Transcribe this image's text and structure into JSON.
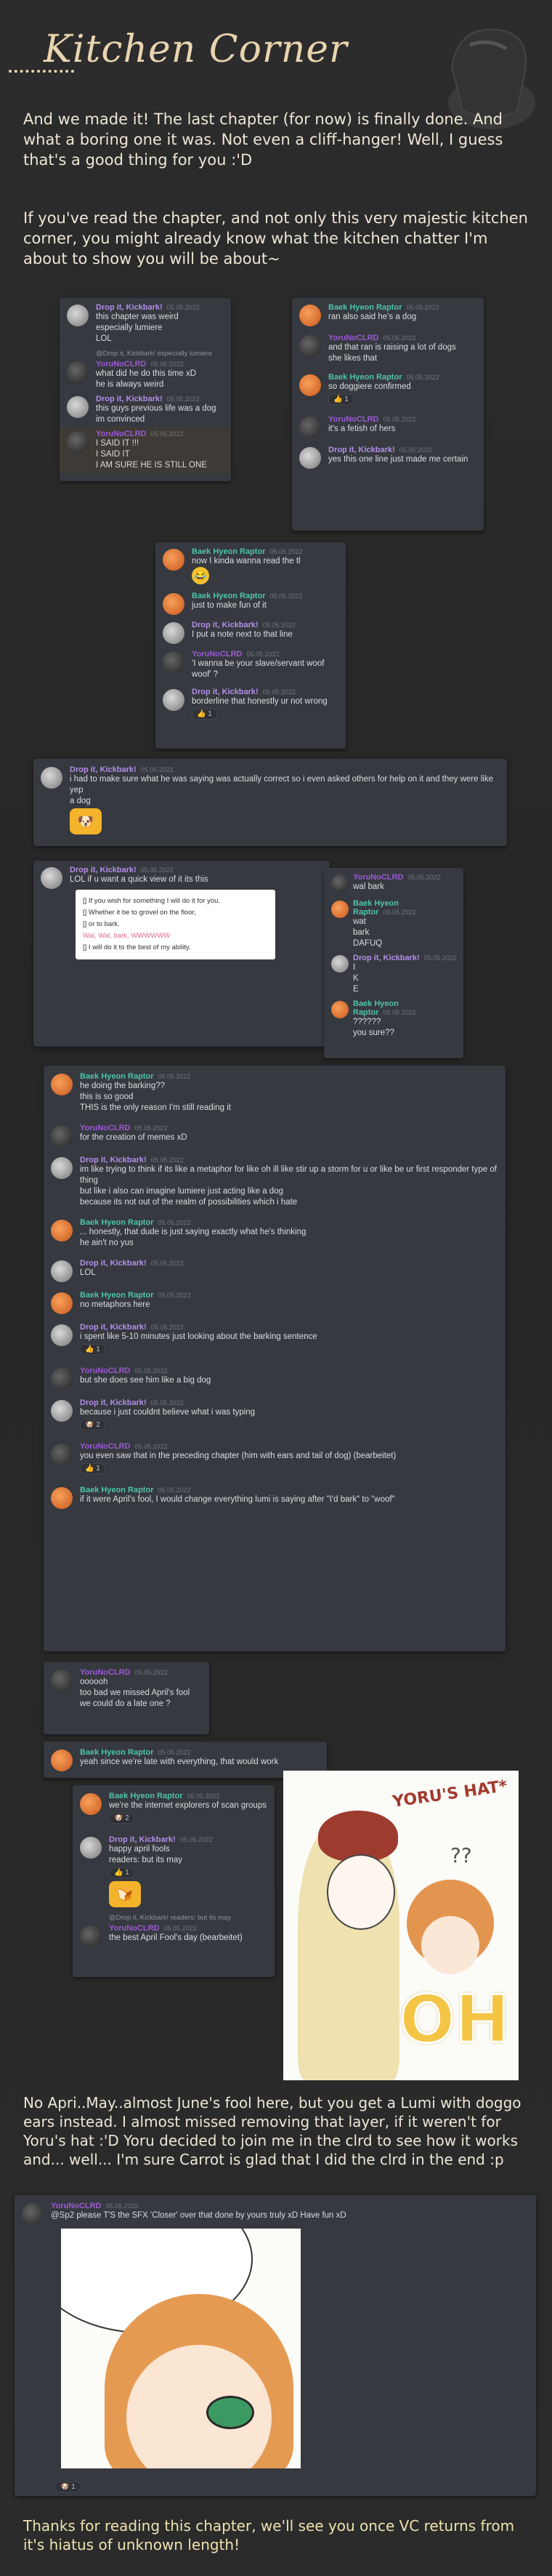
{
  "header": {
    "title": "Kitchen Corner",
    "decor_icon": "cooking-pot-icon"
  },
  "intro": {
    "p1": "And we made it! The last chapter (for now) is finally done. And what a boring one it was. Not even a cliff-hanger! Well, I guess that's a good thing for you :'D",
    "p2": "If you've read the chapter, and not only this very majestic kitchen corner, you might already know what the kitchen chatter I'm about to show you will be about~"
  },
  "mid_text": "No Apri..May..almost June's fool here, but you get a Lumi with doggo ears instead. I almost missed removing that layer, if it weren't for Yoru's hat :'D Yoru decided to join me in the clrd to see how it works and... well... I'm sure Carrot is glad that I did the clrd in the end :p",
  "outro": "Thanks for reading this chapter, we'll see you once VC returns from it's hiatus of unknown length!",
  "chat1": {
    "msgs": [
      {
        "user": "Drop it, Kickbark!",
        "time": "05.05.2022",
        "lines": [
          "this chapter was weird",
          "especially lumiere",
          "LOL"
        ]
      },
      {
        "reply": "@Drop it, Kickbark! especially lumiere",
        "user": "YoruNoCLRD",
        "time": "05.05.2022",
        "lines": [
          "what did he do this time xD",
          "he is always weird"
        ]
      },
      {
        "user": "Drop it, Kickbark!",
        "time": "05.05.2022",
        "lines": [
          "this guys previous life was a dog",
          "im convinced"
        ]
      },
      {
        "user": "YoruNoCLRD",
        "time": "05.05.2022",
        "lines": [
          "I SAID IT !!!",
          "I SAID IT",
          "I AM SURE HE IS STILL ONE"
        ]
      }
    ]
  },
  "chat2": {
    "msgs": [
      {
        "user": "Baek Hyeon Raptor",
        "time": "05.05.2022",
        "lines": [
          "ran also said he's a dog"
        ]
      },
      {
        "user": "YoruNoCLRD",
        "time": "05.05.2022",
        "lines": [
          "and that ran is raising a lot of dogs",
          "she likes that"
        ]
      },
      {
        "user": "Baek Hyeon Raptor",
        "time": "05.05.2022",
        "lines": [
          "so doggiere confirmed"
        ],
        "reaction": "1"
      },
      {
        "user": "YoruNoCLRD",
        "time": "05.05.2022",
        "lines": [
          "it's a fetish of hers"
        ]
      },
      {
        "user": "Drop it, Kickbark!",
        "time": "05.05.2022",
        "lines": [
          "yes this one line just made me certain"
        ]
      }
    ]
  },
  "chat3": {
    "msgs": [
      {
        "user": "Baek Hyeon Raptor",
        "time": "05.05.2022",
        "lines": [
          "now I kinda wanna read the tl"
        ]
      },
      {
        "user": "Baek Hyeon Raptor",
        "time": "05.05.2022",
        "lines": [
          "just to make fun of it"
        ]
      },
      {
        "user": "Drop it, Kickbark!",
        "time": "05.05.2022",
        "lines": [
          "I put a note next to that line"
        ]
      },
      {
        "user": "YoruNoCLRD",
        "time": "05.05.2022",
        "lines": [
          "'I wanna be your slave/servant woof woof' ?"
        ]
      },
      {
        "user": "Drop it, Kickbark!",
        "time": "05.05.2022",
        "lines": [
          "borderline that honestly ur not wrong"
        ],
        "reaction": "1"
      }
    ]
  },
  "chat4": {
    "msgs": [
      {
        "user": "Drop it, Kickbark!",
        "time": "05.05.2022",
        "lines": [
          "i had to make sure what he was saying was actually correct so i even asked others for help on it and they were like yep",
          "a dog"
        ]
      }
    ]
  },
  "chat5": {
    "msgs": [
      {
        "user": "Drop it, Kickbark!",
        "time": "05.05.2022",
        "lines": [
          "LOL if u want a quick view of it its this"
        ]
      }
    ],
    "popup": [
      "[] If you wish for something I will do it for you.",
      "[] Whether it be to grovel on the floor,",
      "[] or to bark.",
      "Wal, Wal, bark, WWWWWW",
      "[] I will do it to the best of my ability."
    ]
  },
  "chat6": {
    "msgs": [
      {
        "user": "YoruNoCLRD",
        "time": "05.05.2022",
        "lines": [
          "wal bark"
        ]
      },
      {
        "user": "Baek Hyeon Raptor",
        "time": "05.05.2022",
        "lines": [
          "wat",
          "bark",
          "DAFUQ"
        ]
      },
      {
        "user": "Drop it, Kickbark!",
        "time": "05.05.2022",
        "lines": [
          "I",
          "K",
          "E"
        ]
      },
      {
        "user": "Baek Hyeon Raptor",
        "time": "05.05.2022",
        "lines": [
          "??????",
          "you sure??"
        ]
      }
    ]
  },
  "chat7": {
    "msgs": [
      {
        "user": "Baek Hyeon Raptor",
        "time": "05.05.2022",
        "lines": [
          "he doing the barking??",
          "this is so good",
          "THIS is the only reason I'm still reading it"
        ]
      },
      {
        "user": "YoruNoCLRD",
        "time": "05.05.2022",
        "lines": [
          "for the creation of memes xD"
        ]
      },
      {
        "user": "Drop it, Kickbark!",
        "time": "05.05.2022",
        "lines": [
          "im like trying to think if its like a metaphor for like oh ill like stir up a storm for u or like be ur first responder type of thing",
          "but like i also can imagine lumiere just acting like a dog",
          "because its not out of the realm of possibilities which i hate"
        ]
      },
      {
        "user": "Baek Hyeon Raptor",
        "time": "05.05.2022",
        "lines": [
          "... honestly, that dude is just saying exactly what he's thinking",
          "he ain't no yus"
        ]
      },
      {
        "user": "Drop it, Kickbark!",
        "time": "05.05.2022",
        "lines": [
          "LOL"
        ]
      },
      {
        "user": "Baek Hyeon Raptor",
        "time": "05.05.2022",
        "lines": [
          "no metaphors here"
        ]
      },
      {
        "user": "Drop it, Kickbark!",
        "time": "05.05.2022",
        "lines": [
          "i spent like 5-10 minutes just looking about the barking sentence"
        ],
        "reaction": "1"
      },
      {
        "user": "YoruNoCLRD",
        "time": "05.05.2022",
        "lines": [
          "but she does see him like a big dog"
        ]
      },
      {
        "user": "Drop it, Kickbark!",
        "time": "05.05.2022",
        "lines": [
          "because i just couldnt believe what i was typing"
        ],
        "reaction": "2"
      },
      {
        "user": "YoruNoCLRD",
        "time": "05.05.2022",
        "lines": [
          "you even saw that in the preceding chapter (him with ears and tail of dog) (bearbeitet)"
        ],
        "reaction": "1"
      },
      {
        "user": "Baek Hyeon Raptor",
        "time": "05.05.2022",
        "lines": [
          "if it were April's fool, I would change everything lumi is saying after \"I'd bark\" to \"woof\""
        ]
      }
    ]
  },
  "chat8": {
    "msgs": [
      {
        "user": "YoruNoCLRD",
        "time": "05.05.2022",
        "lines": [
          "oooooh",
          "too bad we missed April's fool",
          "we could do a late one ?"
        ]
      }
    ]
  },
  "chat9": {
    "msgs": [
      {
        "user": "Baek Hyeon Raptor",
        "time": "05.05.2022",
        "lines": [
          "yeah since we're late with everything, that would work"
        ]
      }
    ]
  },
  "chat10": {
    "msgs": [
      {
        "user": "Baek Hyeon Raptor",
        "time": "05.05.2022",
        "lines": [
          "we're the internet explorers of scan groups"
        ],
        "reaction": "2"
      },
      {
        "user": "Drop it, Kickbark!",
        "time": "05.05.2022",
        "lines": [
          "happy april fools",
          "readers: but its may"
        ],
        "reaction": "1",
        "sticker": true
      },
      {
        "reply": "@Drop it, Kickbark! readers: but its may",
        "user": "YoruNoCLRD",
        "time": "05.05.2022",
        "lines": [
          "the best April Fool's day (bearbeitet)"
        ]
      }
    ]
  },
  "manga1": {
    "sfx_hat": "YORU'S HAT*",
    "sfx_oh": "OH",
    "sfx_q": "??"
  },
  "chat11": {
    "msgs": [
      {
        "user": "YoruNoCLRD",
        "time": "05.05.2022",
        "lines": [
          "@Sp2 please T'S the SFX 'Closer' over that done by yours truly xD Have fun xD"
        ],
        "reaction": "1"
      }
    ]
  },
  "colors": {
    "drop": "#b48ee8",
    "baek": "#4fc3a9",
    "yoru": "#9b59d6",
    "title": "#e9d4b0"
  }
}
